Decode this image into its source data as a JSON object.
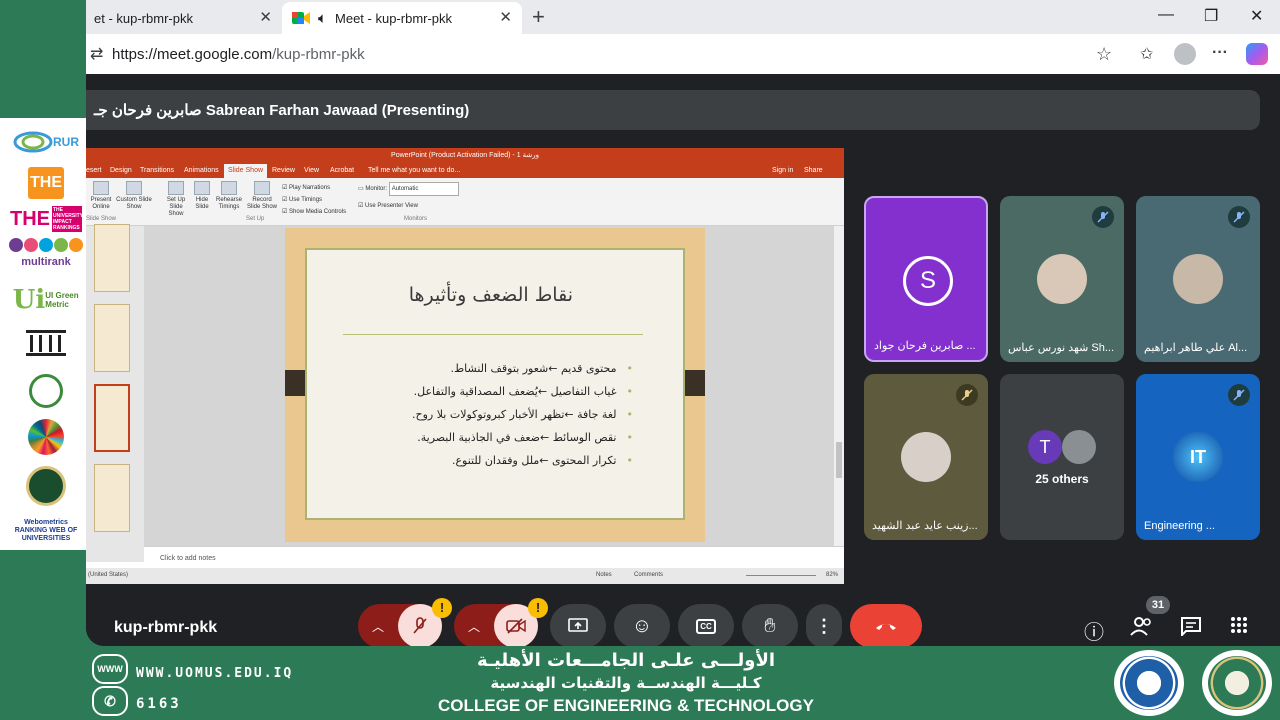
{
  "browser": {
    "tabs": [
      {
        "title": "et - kup-rbmr-pkk"
      },
      {
        "title": "Meet - kup-rbmr-pkk"
      }
    ],
    "url_host": "https://meet.google.com",
    "url_path": "/kup-rbmr-pkk"
  },
  "meet": {
    "presenter_banner": "صابرين فرحان جـ Sabrean Farhan Jawaad (Presenting)",
    "meeting_code": "kup-rbmr-pkk",
    "participant_count": "31",
    "colors": {
      "accent": "#8430ce",
      "end_call": "#ea4335",
      "warning": "#fbbc04",
      "tile_bg": "#3c4043"
    }
  },
  "powerpoint": {
    "window_title": "PowerPoint (Product Activation Failed) - ورشة 1",
    "ribbon_tabs": [
      "esert",
      "Design",
      "Transitions",
      "Animations",
      "Slide Show",
      "Review",
      "View",
      "Acrobat",
      "Tell me what you want to do..."
    ],
    "active_tab": "Slide Show",
    "signin": "Sign in",
    "share": "Share",
    "ribbon_buttons": [
      "Present Online",
      "Custom Slide Show",
      "Set Up Slide Show",
      "Hide Slide",
      "Rehearse Timings",
      "Record Slide Show"
    ],
    "checkboxes": [
      "Play Narrations",
      "Use Timings",
      "Show Media Controls"
    ],
    "monitor_label": "Monitor:",
    "monitor_value": "Automatic",
    "presenter_view": "Use Presenter View",
    "groups": [
      "Slide Show",
      "Set Up",
      "Monitors"
    ],
    "notes_placeholder": "Click to add notes",
    "status_lang": "(United States)",
    "status_notes": "Notes",
    "status_comments": "Comments",
    "zoom": "82%"
  },
  "slide": {
    "title": "نقاط الضعف وتأثيرها",
    "bullets": [
      "محتوى قديم ←شعور بتوقف النشاط.",
      "غياب التفاصيل ←يُضعف المصداقية والتفاعل.",
      "لغة جافة ←تظهر الأخبار كبروتوكولات بلا روح.",
      "نقص الوسائط ←ضعف في الجاذبية البصرية.",
      "تكرار المحتوى ←ملل وفقدان للتنوع."
    ]
  },
  "participants": [
    {
      "name": "صابرين فرحان جواد ...",
      "initial": "S"
    },
    {
      "name": "شهد نورس عباس Sh...",
      "initial": ""
    },
    {
      "name": "علي طاهر ابراهيم Al...",
      "initial": ""
    },
    {
      "name": "زينب عايد عبد الشهيد...",
      "initial": ""
    },
    {
      "name": "25 others",
      "initial": "T"
    },
    {
      "name": "Engineering ...",
      "initial": "IT"
    }
  ],
  "logos": [
    "RUR",
    "THE",
    "THE UNIVERSITY IMPACT RANKINGS",
    "multirank",
    "UI Green Metric",
    "World University Rankings",
    "Webometrics RANKING WEB OF UNIVERSITIES"
  ],
  "footer": {
    "website": "WWW.UOMUS.EDU.IQ",
    "phone": "6163",
    "arabic_line1": "الأولـــى علـى الجامـــعات الأهليـة",
    "arabic_line2": "كـليـــة الهندســة والتقنيات الهندسية",
    "english": "COLLEGE OF ENGINEERING & TECHNOLOGY"
  }
}
